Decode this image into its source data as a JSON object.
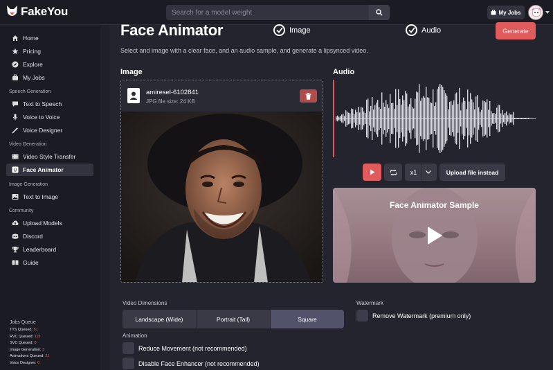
{
  "brand": {
    "name": "FakeYou"
  },
  "search": {
    "placeholder": "Search for a model weight"
  },
  "header": {
    "my_jobs": "My Jobs"
  },
  "sidebar": {
    "main": [
      {
        "label": "Home",
        "icon": "home-icon"
      },
      {
        "label": "Pricing",
        "icon": "star-icon"
      },
      {
        "label": "Explore",
        "icon": "compass-icon"
      },
      {
        "label": "My Jobs",
        "icon": "jobs-icon"
      }
    ],
    "sections": {
      "speech": "Speech Generation",
      "video": "Video Generation",
      "image": "Image Generation",
      "community": "Community"
    },
    "speech_items": [
      {
        "label": "Text to Speech",
        "icon": "message-icon"
      },
      {
        "label": "Voice to Voice",
        "icon": "microphone-icon"
      },
      {
        "label": "Voice Designer",
        "icon": "wand-icon"
      }
    ],
    "video_items": [
      {
        "label": "Video Style Transfer",
        "icon": "film-icon"
      },
      {
        "label": "Face Animator",
        "icon": "face-icon",
        "active": true
      }
    ],
    "image_items": [
      {
        "label": "Text to Image",
        "icon": "image-icon"
      }
    ],
    "community_items": [
      {
        "label": "Upload Models",
        "icon": "cloud-upload-icon"
      },
      {
        "label": "Discord",
        "icon": "discord-icon"
      },
      {
        "label": "Leaderboard",
        "icon": "trophy-icon"
      },
      {
        "label": "Guide",
        "icon": "book-icon"
      }
    ]
  },
  "jobs_queue": {
    "title": "Jobs Queue",
    "rows": [
      {
        "label": "TTS Queued:",
        "value": "61"
      },
      {
        "label": "RVC Queued:",
        "value": "119"
      },
      {
        "label": "SVC Queued:",
        "value": "0"
      },
      {
        "label": "Image Generation:",
        "value": "3"
      },
      {
        "label": "Animations Queued:",
        "value": "21"
      },
      {
        "label": "Voice Designer:",
        "value": "0"
      }
    ]
  },
  "main": {
    "title": "Face Animator",
    "step_image": "Image",
    "step_audio": "Audio",
    "generate": "Generate",
    "subtitle": "Select and image with a clear face, and an audio sample, and generate a lipsynced video.",
    "image_heading": "Image",
    "audio_heading": "Audio"
  },
  "file": {
    "name": "amiresel-6102841",
    "size": "JPG file size: 24 KB"
  },
  "audio_controls": {
    "speed": "x1",
    "upload": "Upload file instead"
  },
  "sample": {
    "title": "Face Animator Sample"
  },
  "settings": {
    "dimensions_label": "Video Dimensions",
    "dimensions": [
      "Landscape (Wide)",
      "Portrait (Tall)",
      "Square"
    ],
    "selected_dimension": "Square",
    "watermark_label": "Watermark",
    "remove_watermark": "Remove Watermark (premium only)",
    "animation_label": "Animation",
    "reduce_movement": "Reduce Movement (not recommended)",
    "disable_enhancer": "Disable Face Enhancer (not recommended)"
  },
  "colors": {
    "accent": "#e05b5b",
    "bg": "#24242f",
    "sidebar": "#1b1b24"
  }
}
